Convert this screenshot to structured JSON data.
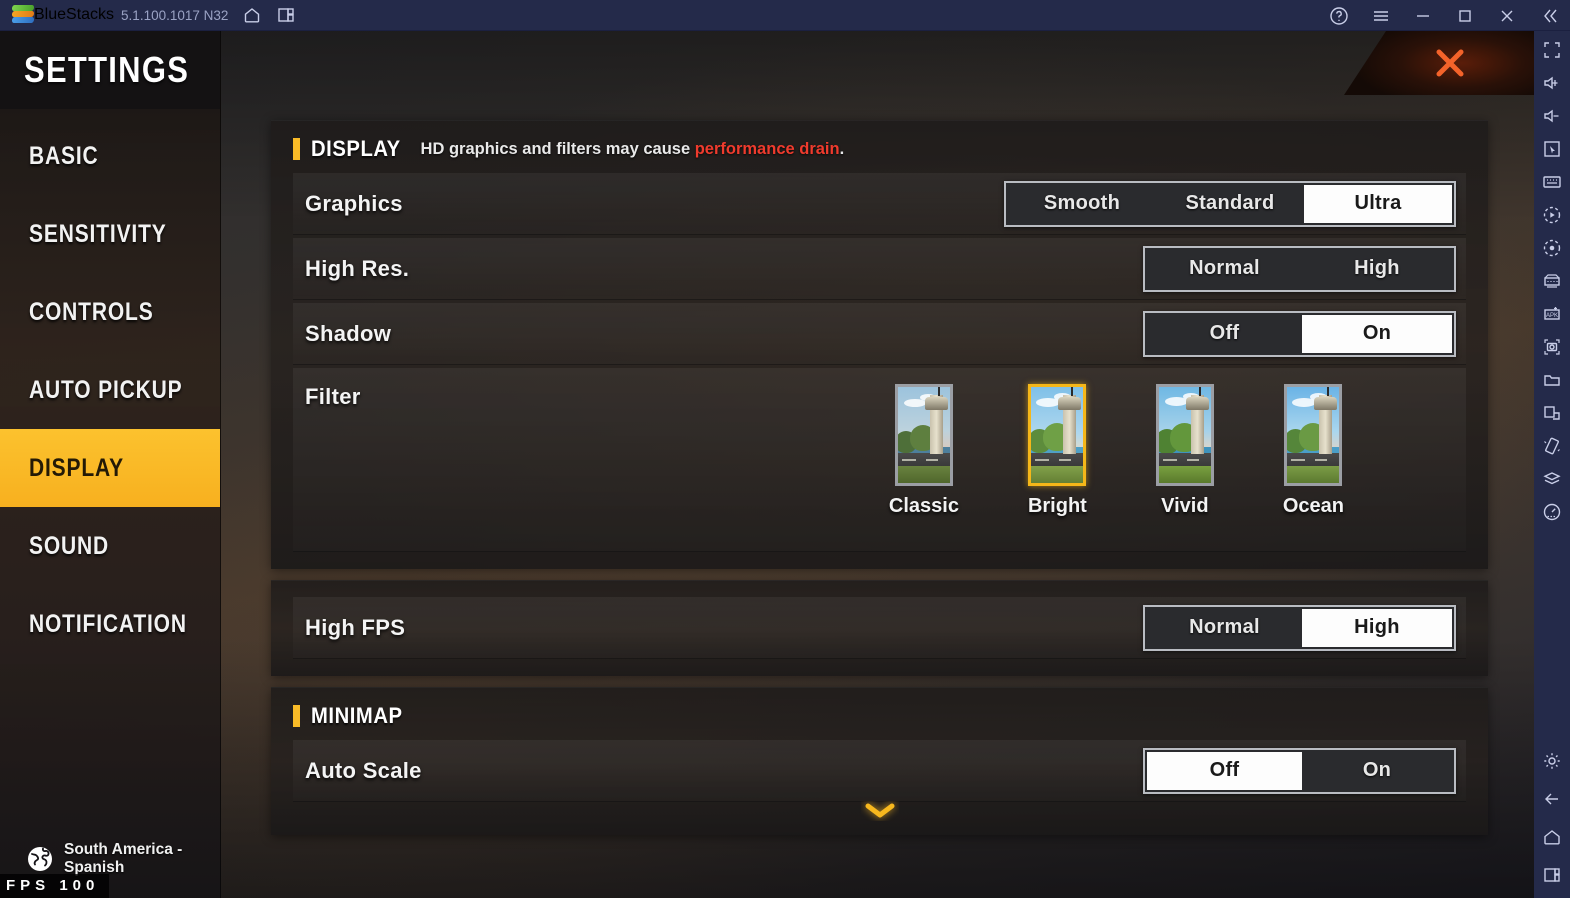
{
  "titlebar": {
    "app_name": "BlueStacks",
    "version": "5.1.100.1017 N32",
    "icons": [
      "home-icon",
      "multi-instance-icon"
    ],
    "controls": [
      "help-icon",
      "menu-icon",
      "minimize-icon",
      "maximize-icon",
      "close-icon",
      "collapse-icon"
    ]
  },
  "sidebar": {
    "title": "SETTINGS",
    "items": [
      {
        "label": "BASIC",
        "active": false
      },
      {
        "label": "SENSITIVITY",
        "active": false
      },
      {
        "label": "CONTROLS",
        "active": false
      },
      {
        "label": "AUTO PICKUP",
        "active": false
      },
      {
        "label": "DISPLAY",
        "active": true
      },
      {
        "label": "SOUND",
        "active": false
      },
      {
        "label": "NOTIFICATION",
        "active": false
      }
    ],
    "region": "South America -\nSpanish",
    "region_line1": "South America -",
    "region_line2": "Spanish",
    "fps_badge": "FPS 100"
  },
  "close_button": {
    "label": "✕"
  },
  "display_section": {
    "title": "DISPLAY",
    "note_prefix": "HD graphics and filters may cause ",
    "note_warning": "performance drain",
    "note_suffix": ".",
    "rows": [
      {
        "label": "Graphics",
        "options": [
          "Smooth",
          "Standard",
          "Ultra"
        ],
        "selected": "Ultra"
      },
      {
        "label": "High Res.",
        "options": [
          "Normal",
          "High"
        ],
        "selected": "High"
      },
      {
        "label": "Shadow",
        "options": [
          "Off",
          "On"
        ],
        "selected": "On"
      }
    ],
    "filter_row": {
      "label": "Filter",
      "filters": [
        {
          "name": "Classic",
          "selected": false
        },
        {
          "name": "Bright",
          "selected": true
        },
        {
          "name": "Vivid",
          "selected": false
        },
        {
          "name": "Ocean",
          "selected": false
        }
      ]
    }
  },
  "fps_section": {
    "rows": [
      {
        "label": "High FPS",
        "options": [
          "Normal",
          "High"
        ],
        "selected": "High"
      }
    ]
  },
  "minimap_section": {
    "title": "MINIMAP",
    "rows": [
      {
        "label": "Auto Scale",
        "options": [
          "Off",
          "On"
        ],
        "selected": "Off"
      }
    ]
  },
  "colors": {
    "accent_yellow": "#f9bb27",
    "warning_red": "#ef3b2d",
    "close_orange": "#f05a28",
    "titlebar_navy": "#242a4a"
  },
  "rail": {
    "icons": [
      "fullscreen-icon",
      "volume-up-icon",
      "volume-down-icon",
      "cursor-icon",
      "keyboard-icon",
      "macro-icon",
      "record-icon",
      "gamepad-controls-icon",
      "install-apk-icon",
      "screenshot-icon",
      "media-folder-icon",
      "copy-paste-icon",
      "shake-icon",
      "multi-instance-icon",
      "eco-mode-icon"
    ],
    "bottom_icons": [
      "settings-gear-icon",
      "back-icon",
      "home-icon",
      "recents-icon"
    ]
  }
}
